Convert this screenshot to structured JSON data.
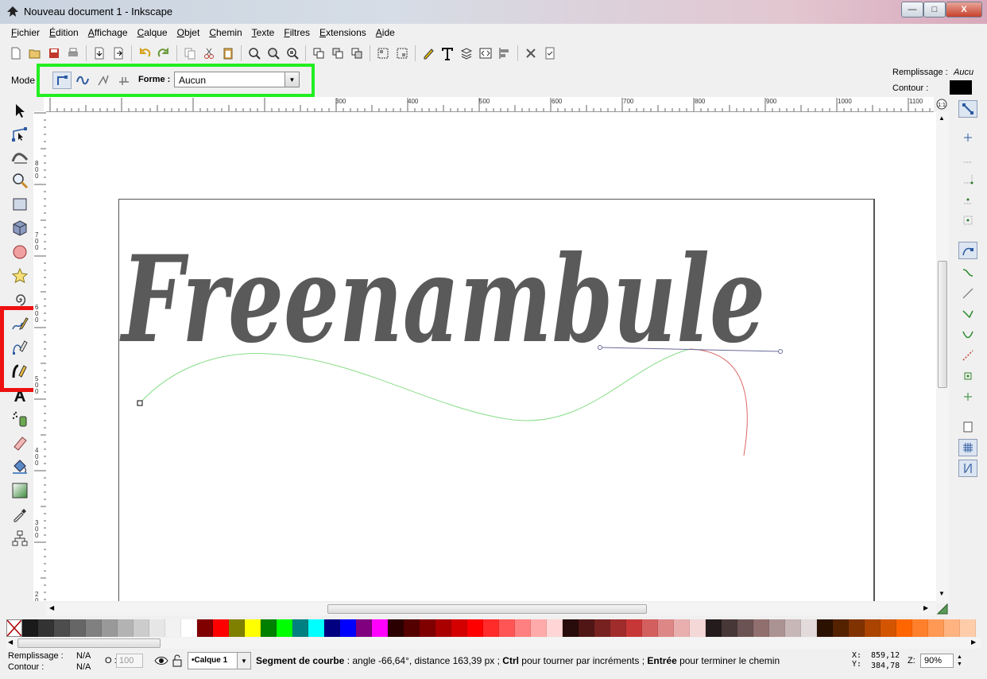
{
  "window": {
    "title": "Nouveau document 1 - Inkscape",
    "minimize_label": "—",
    "maximize_label": "□",
    "close_label": "X"
  },
  "menu": [
    "Fichier",
    "Édition",
    "Affichage",
    "Calque",
    "Objet",
    "Chemin",
    "Texte",
    "Filtres",
    "Extensions",
    "Aide"
  ],
  "toolbar": {
    "icons": [
      "new-document-icon",
      "open-icon",
      "save-icon",
      "print-icon",
      "import-icon",
      "export-icon",
      "undo-icon",
      "redo-icon",
      "copy-icon",
      "cut-icon",
      "paste-icon",
      "zoom-selection-icon",
      "zoom-drawing-icon",
      "zoom-page-icon",
      "duplicate-icon",
      "clone-icon",
      "unlink-clone-icon",
      "group-icon",
      "ungroup-icon",
      "fill-stroke-icon",
      "text-font-icon",
      "layers-icon",
      "xml-editor-icon",
      "align-icon",
      "preferences-icon",
      "document-properties-icon"
    ]
  },
  "controls": {
    "mode_label": "Mode",
    "mode_buttons": [
      "bezier-mode-icon",
      "spiro-mode-icon",
      "zigzag-mode-icon",
      "paraxial-mode-icon"
    ],
    "shape_label": "Forme :",
    "shape_value": "Aucun"
  },
  "fill_stroke": {
    "fill_label": "Remplissage :",
    "fill_value": "Aucu",
    "stroke_label": "Contour :",
    "stroke_color": "#000000"
  },
  "tools": [
    "selector-icon",
    "node-icon",
    "tweak-icon",
    "zoom-icon",
    "rectangle-icon",
    "box3d-icon",
    "ellipse-icon",
    "star-icon",
    "spiral-icon",
    "pencil-icon",
    "pen-icon",
    "calligraphy-icon",
    "text-icon",
    "spray-icon",
    "eraser-icon",
    "paint-bucket-icon",
    "gradient-icon",
    "dropper-icon",
    "connector-icon"
  ],
  "ruler": {
    "h_labels": [
      "300",
      "400",
      "500",
      "600",
      "700",
      "800",
      "900",
      "1000",
      "1100"
    ],
    "v_labels": [
      "800",
      "700",
      "600",
      "500",
      "400",
      "300",
      "200"
    ],
    "zoom_corner": "1:1"
  },
  "canvas": {
    "text": "Freenambule",
    "text_color": "#5a5a5a",
    "curve_color": "#88dd88",
    "next_segment_color": "#dd6666",
    "handle_color": "#6a6a9a"
  },
  "highlights": {
    "green": "#22ee22",
    "red": "#ee1111"
  },
  "palette": [
    "#1a1a1a",
    "#333333",
    "#4d4d4d",
    "#666666",
    "#808080",
    "#999999",
    "#b3b3b3",
    "#cccccc",
    "#e6e6e6",
    "#f2f2f2",
    "#ffffff",
    "#800000",
    "#ff0000",
    "#808000",
    "#ffff00",
    "#008000",
    "#00ff00",
    "#008080",
    "#00ffff",
    "#000080",
    "#0000ff",
    "#800080",
    "#ff00ff",
    "#2b0000",
    "#550000",
    "#800000",
    "#aa0000",
    "#d40000",
    "#ff0000",
    "#ff2a2a",
    "#ff5555",
    "#ff8080",
    "#ffaaaa",
    "#ffd5d5",
    "#280b0b",
    "#501616",
    "#782121",
    "#a02c2c",
    "#c83737",
    "#d35f5f",
    "#de8787",
    "#e9afaf",
    "#f4d7d7",
    "#241c1c",
    "#483737",
    "#6c5353",
    "#916f6f",
    "#ac9393",
    "#c8b7b7",
    "#e3dbdb",
    "#2b1100",
    "#552200",
    "#803300",
    "#aa4400",
    "#d45500",
    "#ff6600",
    "#ff7f2a",
    "#ff9955",
    "#ffb380",
    "#ffccaa"
  ],
  "status": {
    "fill_label": "Remplissage :",
    "fill_value": "N/A",
    "stroke_label": "Contour :",
    "stroke_value": "N/A",
    "opacity_label": "O :",
    "opacity_value": "100",
    "layer": "•Calque 1",
    "message_bold1": "Segment de courbe",
    "message_1": " : angle -66,64°, distance 163,39 px ; ",
    "message_bold2": "Ctrl",
    "message_2": " pour tourner par incréments ; ",
    "message_bold3": "Entrée",
    "message_3": " pour terminer le chemin",
    "x_label": "X:",
    "x_value": "859,12",
    "y_label": "Y:",
    "y_value": "384,78",
    "zoom_label": "Z:",
    "zoom_value": "90%"
  }
}
